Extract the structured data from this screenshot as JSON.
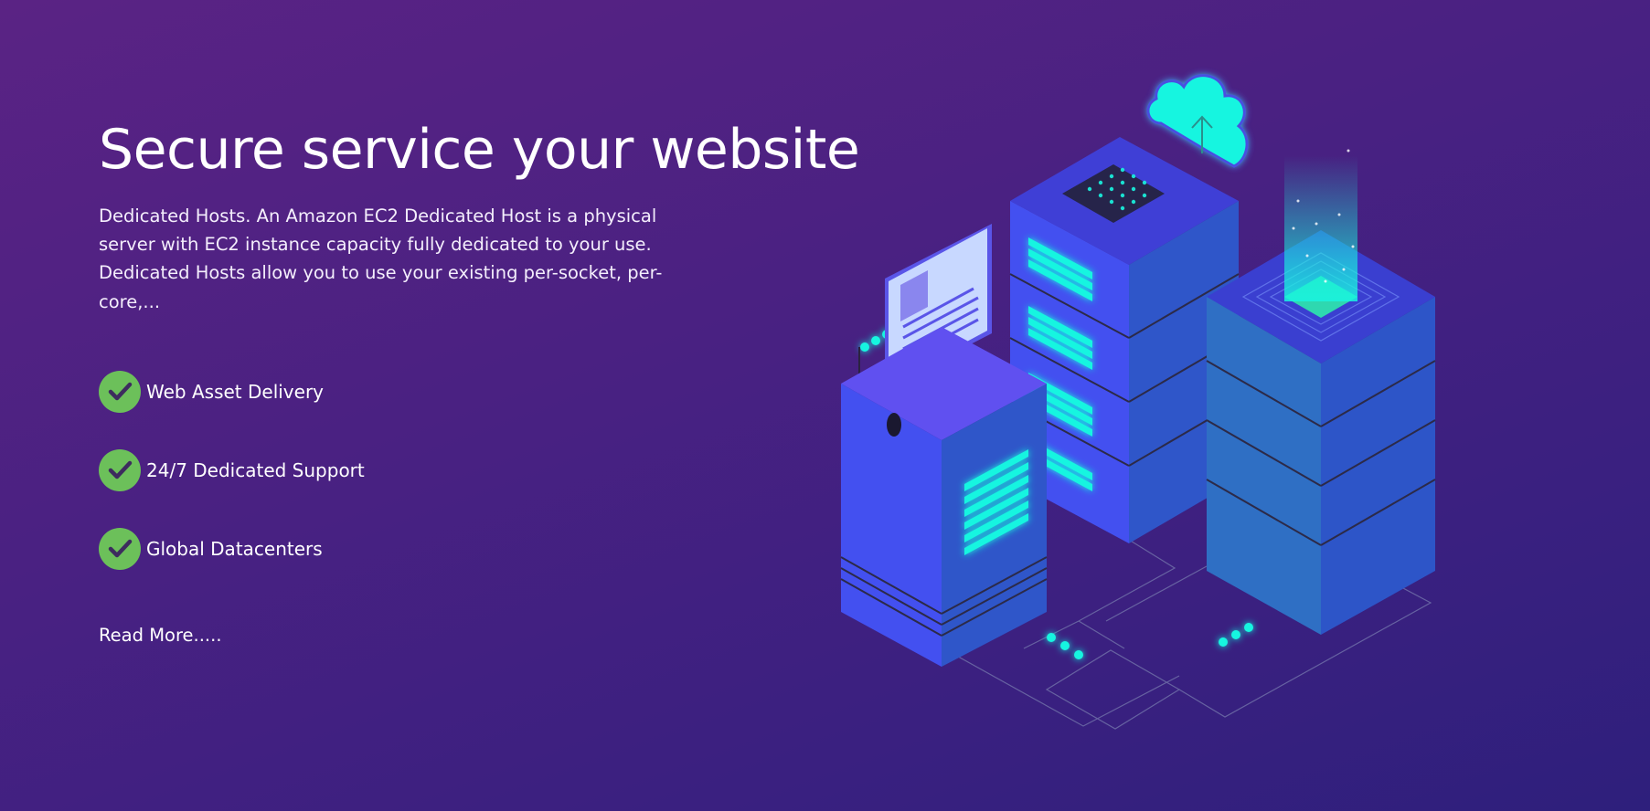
{
  "hero": {
    "title": "Secure service your website",
    "description": "Dedicated Hosts. An Amazon EC2 Dedicated Host is a physical server with EC2 instance capacity fully dedicated to your use. Dedicated Hosts allow you to use your existing per-socket, per-core,...",
    "features": [
      {
        "label": "Web Asset Delivery",
        "icon": "checkmark-icon"
      },
      {
        "label": "24/7 Dedicated Support",
        "icon": "checkmark-icon"
      },
      {
        "label": "Global Datacenters",
        "icon": "checkmark-icon"
      }
    ],
    "read_more_label": "Read More....."
  },
  "colors": {
    "background_start": "#5a2384",
    "background_end": "#2e1f7c",
    "check_green": "#6cc05a",
    "check_mark": "#3d2c5e",
    "server_blue": "#4350f0",
    "server_side": "#2f56c9",
    "server_top": "#6a5cf0",
    "cyan_glow": "#19f5e0"
  },
  "illustration": {
    "icons": [
      "cloud-upload-icon",
      "server-tower-icon",
      "server-rack-icon",
      "document-card-icon",
      "network-lines-icon"
    ]
  }
}
